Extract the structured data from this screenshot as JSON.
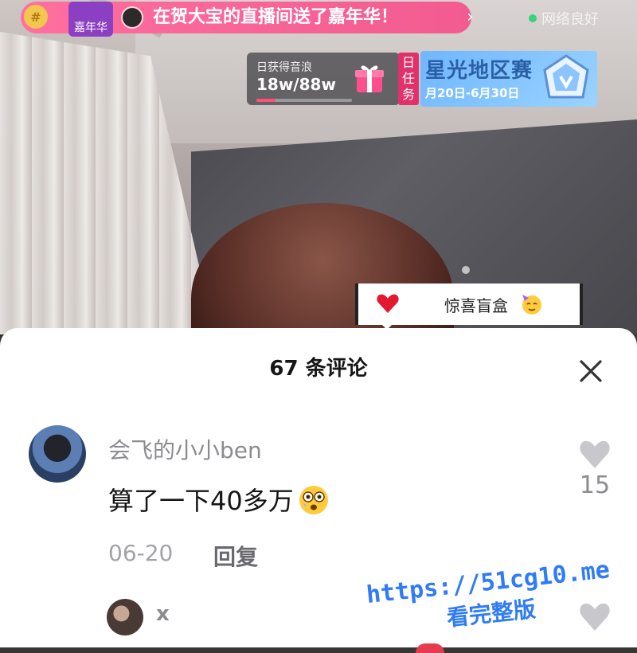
{
  "live_hud": {
    "gift_banner": {
      "tag_label": "嘉年华",
      "message": "在贺大宝的直播间送了嘉年华！",
      "chevron": "›"
    },
    "network_status": "网络良好",
    "sound_wave": {
      "label": "日获得音浪",
      "value": "18w/88w",
      "progress": 0.2
    },
    "daily_task": [
      "日",
      "任",
      "务"
    ],
    "event": {
      "title": "星光地区赛",
      "date": "月20日-6月30日"
    },
    "mystery_box_label": "惊喜盲盒"
  },
  "comments": {
    "title": "67 条评论",
    "items": [
      {
        "user": "会飞的小小ben",
        "text": "算了一下40多万",
        "date": "06-20",
        "reply_label": "回复",
        "likes": "15"
      }
    ],
    "reply_preview": {
      "user": "x"
    }
  },
  "watermark": {
    "line1": "https://51cg10.me",
    "line2": "看完整版"
  },
  "colors": {
    "gift_banner": "#f25b8f",
    "accent_pink": "#e0316b",
    "watermark_blue": "#2f7cf6",
    "muted_text": "#8c8c90"
  },
  "icons": [
    "gift-badge-icon",
    "gift-box-icon",
    "event-emblem-icon",
    "heart-icon",
    "party-emoji-icon",
    "close-icon",
    "wow-emoji-icon",
    "like-heart-icon"
  ]
}
